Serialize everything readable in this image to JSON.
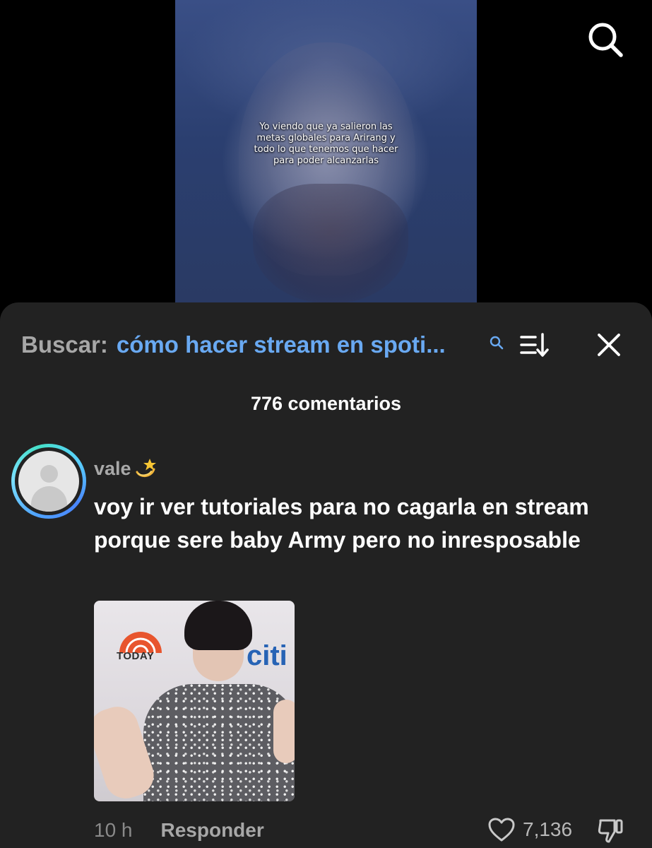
{
  "video": {
    "caption": "Yo viendo que ya salieron las metas globales para Arirang y todo lo que tenemos que hacer para poder alcanzarlas"
  },
  "top_icons": {
    "search": "search-icon"
  },
  "sheet": {
    "search_label": "Buscar:",
    "search_query": "cómo hacer stream en spoti...",
    "icons": [
      "search-small-icon",
      "sort-icon",
      "close-icon"
    ],
    "comment_count": "776 comentarios"
  },
  "comment": {
    "username": "vale",
    "username_emoji": "dizzy-emoji",
    "text": "voy ir ver tutoriales para no cagarla en stream porque sere baby Army pero no inresposable",
    "gif_text": {
      "today": "TODAY",
      "citi": "citi"
    },
    "time": "10 h",
    "reply_label": "Responder",
    "likes": "7,136"
  },
  "colors": {
    "sheet_bg": "#222222",
    "accent_link": "#69a9f2",
    "muted": "#a7a7a7"
  }
}
